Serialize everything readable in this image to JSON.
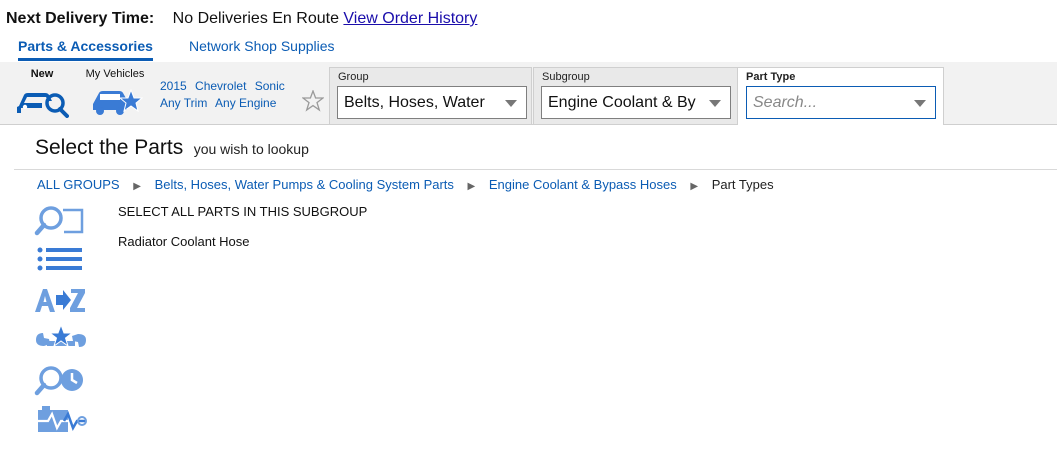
{
  "topbar": {
    "label": "Next Delivery Time:",
    "status": "No Deliveries En Route",
    "history_link": "View Order History"
  },
  "tabs": [
    {
      "label": "Parts & Accessories",
      "active": true
    },
    {
      "label": "Network Shop Supplies",
      "active": false
    }
  ],
  "toolbar": {
    "new_label": "New",
    "my_vehicles_label": "My Vehicles",
    "vehicle": {
      "year": "2015",
      "make": "Chevrolet",
      "model": "Sonic",
      "trim": "Any Trim",
      "engine": "Any Engine"
    },
    "group": {
      "caption": "Group",
      "value": "Belts, Hoses, Water"
    },
    "subgroup": {
      "caption": "Subgroup",
      "value": "Engine Coolant & By"
    },
    "part_type": {
      "caption": "Part Type",
      "placeholder": "Search..."
    }
  },
  "heading": {
    "title": "Select the Parts",
    "subtitle": "you wish to lookup"
  },
  "breadcrumb": [
    "ALL GROUPS",
    "Belts, Hoses, Water Pumps & Cooling System Parts",
    "Engine Coolant & Bypass Hoses",
    "Part Types"
  ],
  "side_icons": [
    "search-parts-icon",
    "list-icon",
    "a-to-z-icon",
    "favorites-tools-icon",
    "search-history-icon",
    "diagnostics-icon"
  ],
  "parts_list": [
    "SELECT ALL PARTS IN THIS SUBGROUP",
    "Radiator Coolant Hose"
  ],
  "colors": {
    "link_blue": "#0b5cb4",
    "icon_blue": "#3a7bd5",
    "icon_light_blue": "#6e9fdf",
    "toolbar_bg": "#f2f2f2"
  }
}
